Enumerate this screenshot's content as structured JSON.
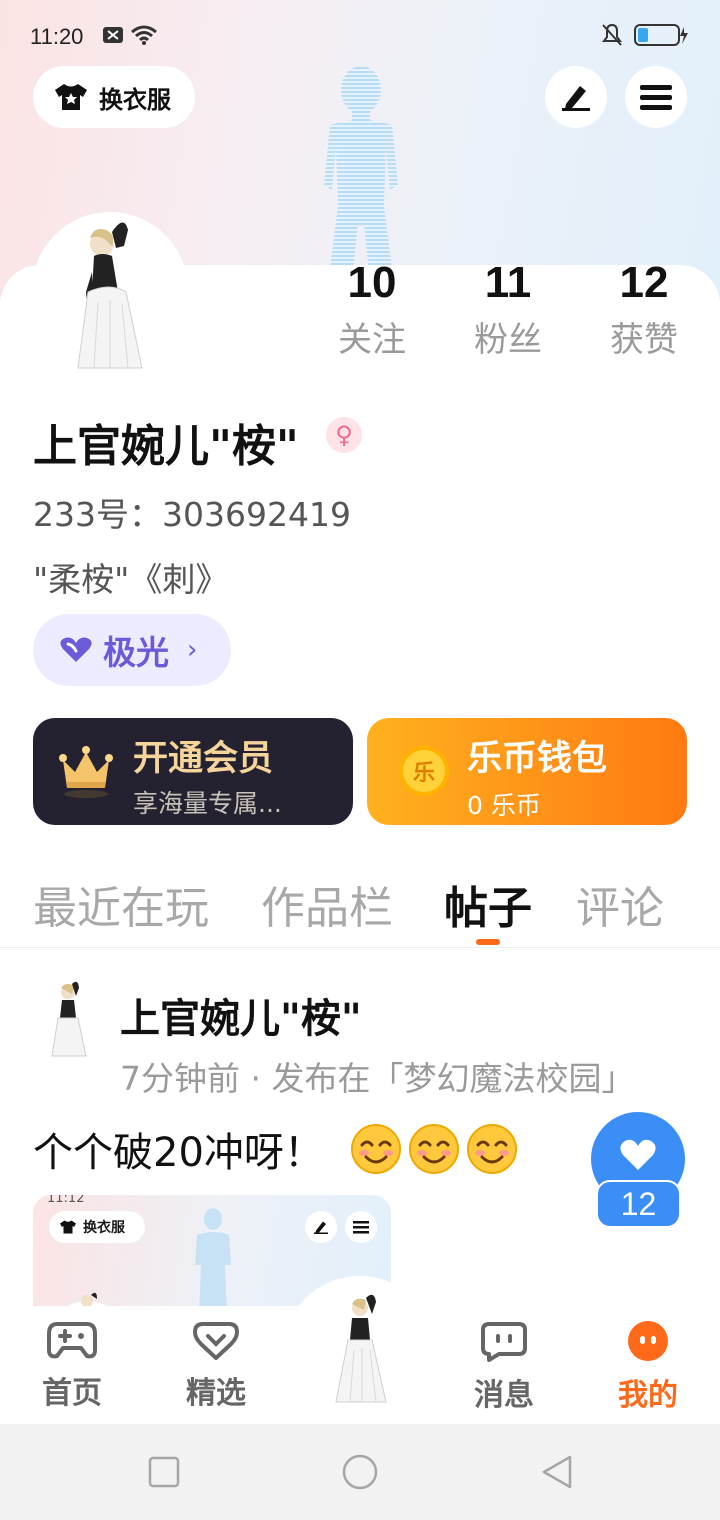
{
  "status_bar": {
    "time": "11:20"
  },
  "header": {
    "dress_label": "换衣服"
  },
  "stats": [
    {
      "num": "10",
      "label": "关注"
    },
    {
      "num": "11",
      "label": "粉丝"
    },
    {
      "num": "12",
      "label": "获赞"
    }
  ],
  "profile": {
    "name": "上官婉儿\"桉\"",
    "gender_symbol": "♀",
    "uid": "233号：303692419",
    "signature": "\"柔桉\"《刺》",
    "badge": "极光",
    "badge_chevron": "›"
  },
  "cards": {
    "vip_title": "开通会员",
    "vip_sub": "享海量专属...",
    "coin_title": "乐币钱包",
    "coin_sub": "0 乐币",
    "coin_glyph": "乐"
  },
  "tabs": [
    "最近在玩",
    "作品栏",
    "帖子",
    "评论"
  ],
  "active_tab_index": 2,
  "post": {
    "author": "上官婉儿\"桉\"",
    "meta": "7分钟前 · 发布在「梦幻魔法校园」",
    "text": "个个破20冲呀！",
    "likes": "12",
    "preview": {
      "time": "11:12",
      "dress_label": "换衣服"
    }
  },
  "bottom_nav": [
    {
      "label": "首页",
      "icon": "gamepad-icon"
    },
    {
      "label": "精选",
      "icon": "heart-bubble-icon"
    },
    {
      "label": "消息",
      "icon": "chat-icon"
    },
    {
      "label": "我的",
      "icon": "me-icon"
    }
  ],
  "colors": {
    "accent": "#ff6a1a",
    "like_blue": "#3b8ef5",
    "badge_purple": "#6b5bd8"
  }
}
